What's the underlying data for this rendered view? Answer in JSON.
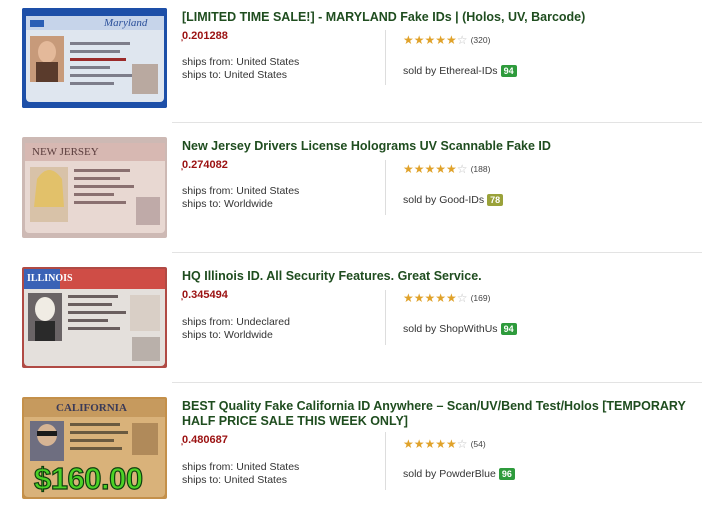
{
  "listings": [
    {
      "title": "[LIMITED TIME SALE!] - MARYLAND Fake IDs | (Holos, UV, Barcode)",
      "price": "̦0.201288",
      "ships_from": "ships from: United States",
      "ships_to": "ships to: United States",
      "rating_count": "(320)",
      "sold_by": "sold by",
      "seller": "Ethereal-IDs",
      "seller_score": "94",
      "badge_color": "#2e9b3c",
      "card_header": "Maryland"
    },
    {
      "title": "New Jersey Drivers License Holograms UV Scannable Fake ID",
      "price": "̦0.274082",
      "ships_from": "ships from: United States",
      "ships_to": "ships to: Worldwide",
      "rating_count": "(188)",
      "sold_by": "sold by",
      "seller": "Good-IDs",
      "seller_score": "78",
      "badge_color": "#9aa23a",
      "card_header": "NEW JERSEY"
    },
    {
      "title": "HQ Illinois ID. All Security Features. Great Service.",
      "price": "̦0.345494",
      "ships_from": "ships from: Undeclared",
      "ships_to": "ships to: Worldwide",
      "rating_count": "(169)",
      "sold_by": "sold by",
      "seller": "ShopWithUs",
      "seller_score": "94",
      "badge_color": "#2e9b3c",
      "card_header": "ILLINOIS"
    },
    {
      "title": "BEST Quality Fake California ID Anywhere – Scan/UV/Bend Test/Holos [TEMPORARY HALF PRICE SALE THIS WEEK ONLY]",
      "price": "̦0.480687",
      "ships_from": "ships from: United States",
      "ships_to": "ships to: United States",
      "rating_count": "(54)",
      "sold_by": "sold by",
      "seller": "PowderBlue",
      "seller_score": "96",
      "badge_color": "#2e9b3c",
      "card_header": "CALIFORNIA",
      "overlay_price": "$160.00"
    }
  ],
  "colors": {
    "title": "#1f4d1f",
    "price": "#9b1111",
    "star_on": "#e0a22a",
    "star_off": "#bfbfbf"
  }
}
